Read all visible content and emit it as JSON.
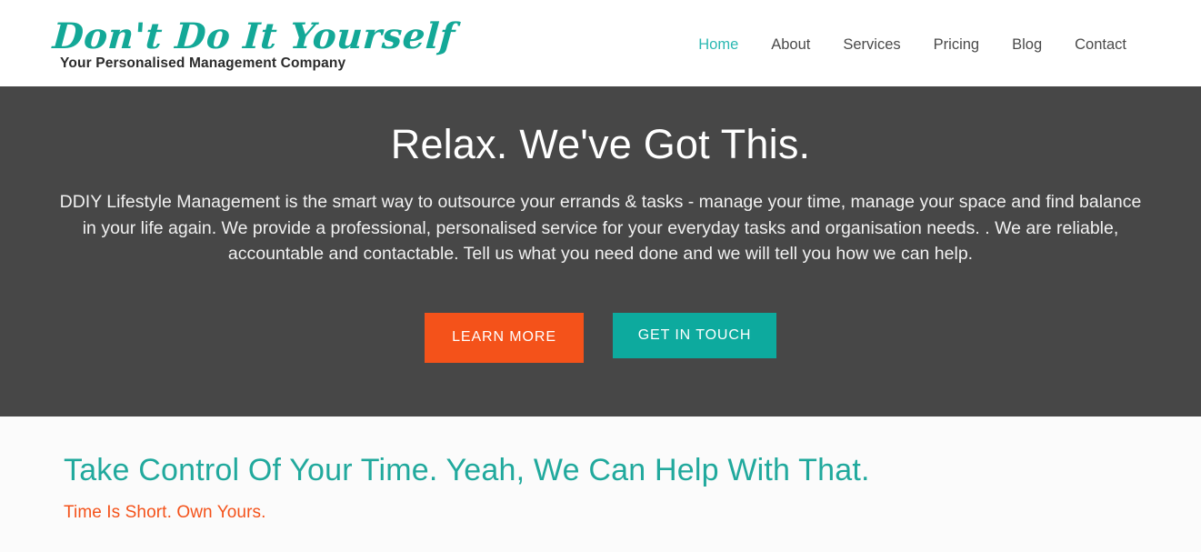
{
  "header": {
    "brand": {
      "wordmark": "Don't Do It Yourself",
      "tagline": "Your Personalised Management Company",
      "color": "#13a897"
    },
    "nav": {
      "active_color": "#2bb8b2",
      "items": [
        {
          "label": "Home",
          "active": true
        },
        {
          "label": "About",
          "active": false
        },
        {
          "label": "Services",
          "active": false
        },
        {
          "label": "Pricing",
          "active": false
        },
        {
          "label": "Blog",
          "active": false
        },
        {
          "label": "Contact",
          "active": false
        }
      ]
    }
  },
  "hero": {
    "background_color": "#474747",
    "title": "Relax. We've Got This.",
    "paragraph": "DDIY Lifestyle Management is the smart way to outsource your errands & tasks - manage your time, manage your space and find balance in your life again. We provide a professional, personalised service for your everyday tasks and organisation needs. . We are reliable, accountable and contactable. Tell us what you need done and we will tell you how we can help.",
    "buttons": [
      {
        "label": "LEARN MORE",
        "color": "#f4521a"
      },
      {
        "label": "GET IN TOUCH",
        "color": "#0daa9e"
      }
    ]
  },
  "intro_section": {
    "background_color": "#fbfbfb",
    "heading": "Take Control Of Your Time. Yeah, We Can Help With That.",
    "heading_color": "#21a99d",
    "subheading": "Time Is Short. Own Yours.",
    "subheading_color": "#f4521a"
  }
}
